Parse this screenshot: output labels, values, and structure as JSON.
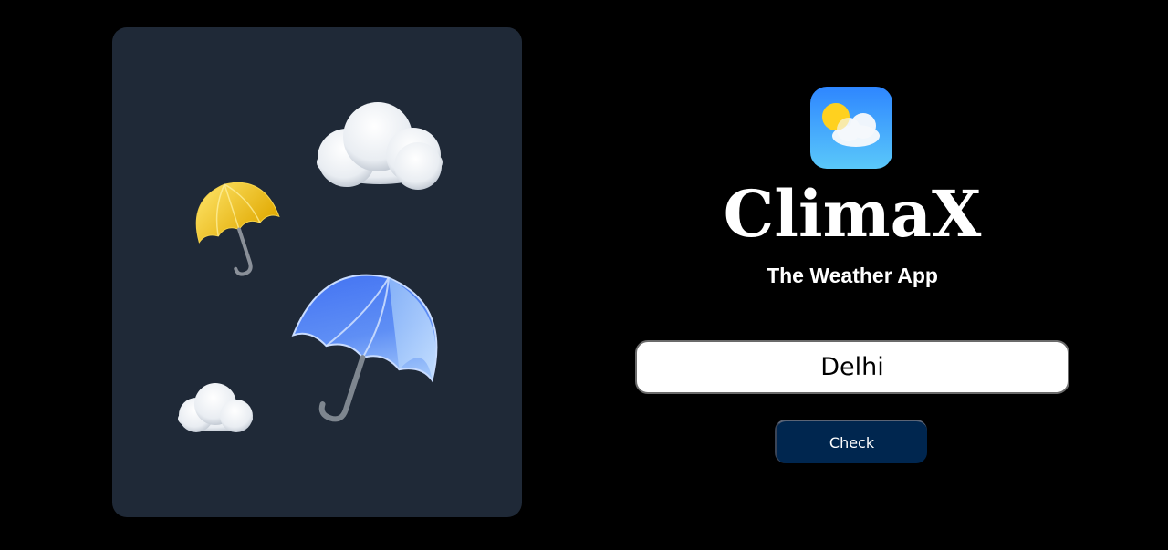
{
  "app": {
    "title": "ClimaX",
    "subtitle": "The Weather App",
    "logo_icon": "weather-sun-cloud-icon"
  },
  "search": {
    "value": "Delhi",
    "placeholder": ""
  },
  "actions": {
    "check_label": "Check"
  },
  "hero": {
    "illustrations": [
      "cloud-icon",
      "yellow-umbrella-icon",
      "blue-umbrella-icon",
      "cloud-icon"
    ]
  },
  "colors": {
    "background": "#000000",
    "panel": "#1f2937",
    "button": "#00264f",
    "text": "#ffffff"
  }
}
